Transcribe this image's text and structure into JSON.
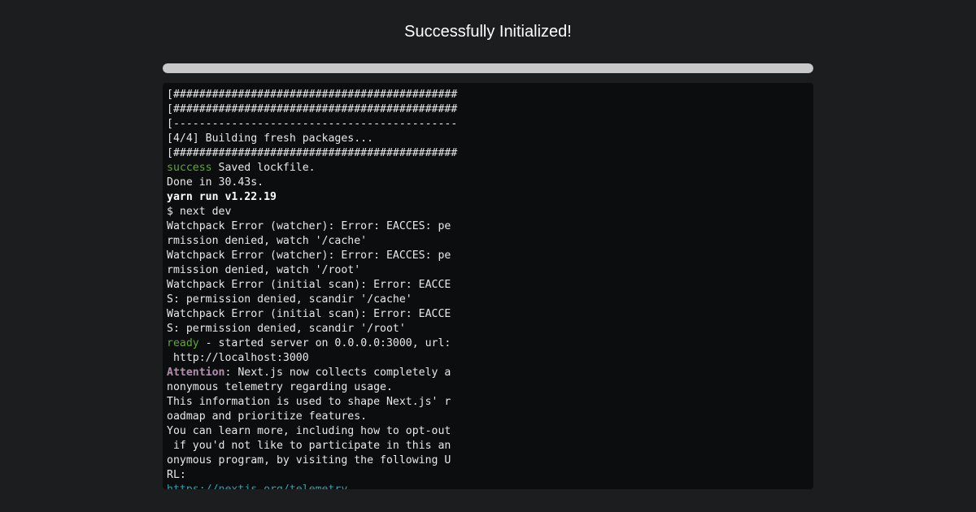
{
  "header": {
    "title": "Successfully Initialized!"
  },
  "progress": {
    "value": 1.0
  },
  "colors": {
    "background": "#1c1d1f",
    "terminal_bg": "#0c0d0e",
    "progress_fill": "#c8c8c8",
    "success_green": "#5fa63a",
    "attention_magenta": "#b48ead",
    "link_cyan": "#2aa1b3"
  },
  "terminal": {
    "lines": [
      [
        {
          "text": "[############################################",
          "style": ""
        }
      ],
      [
        {
          "text": "[############################################",
          "style": ""
        }
      ],
      [
        {
          "text": "[--------------------------------------------",
          "style": ""
        }
      ],
      [
        {
          "text": "[4/4] Building fresh packages...",
          "style": ""
        }
      ],
      [
        {
          "text": "[############################################",
          "style": ""
        }
      ],
      [
        {
          "text": "success",
          "style": "green"
        },
        {
          "text": " Saved lockfile.",
          "style": ""
        }
      ],
      [
        {
          "text": "Done in 30.43s.",
          "style": ""
        }
      ],
      [
        {
          "text": "yarn run v1.22.19",
          "style": "bold"
        }
      ],
      [
        {
          "text": "$ next dev",
          "style": ""
        }
      ],
      [
        {
          "text": "Watchpack Error (watcher): Error: EACCES: pe",
          "style": ""
        }
      ],
      [
        {
          "text": "rmission denied, watch '/cache'",
          "style": ""
        }
      ],
      [
        {
          "text": "Watchpack Error (watcher): Error: EACCES: pe",
          "style": ""
        }
      ],
      [
        {
          "text": "rmission denied, watch '/root'",
          "style": ""
        }
      ],
      [
        {
          "text": "Watchpack Error (initial scan): Error: EACCE",
          "style": ""
        }
      ],
      [
        {
          "text": "S: permission denied, scandir '/cache'",
          "style": ""
        }
      ],
      [
        {
          "text": "Watchpack Error (initial scan): Error: EACCE",
          "style": ""
        }
      ],
      [
        {
          "text": "S: permission denied, scandir '/root'",
          "style": ""
        }
      ],
      [
        {
          "text": "ready",
          "style": "green"
        },
        {
          "text": " - started server on 0.0.0.0:3000, url:",
          "style": ""
        }
      ],
      [
        {
          "text": " http://localhost:3000",
          "style": ""
        }
      ],
      [
        {
          "text": "Attention",
          "style": "magenta"
        },
        {
          "text": ": Next.js now collects completely a",
          "style": ""
        }
      ],
      [
        {
          "text": "nonymous telemetry regarding usage.",
          "style": ""
        }
      ],
      [
        {
          "text": "This information is used to shape Next.js' r",
          "style": ""
        }
      ],
      [
        {
          "text": "oadmap and prioritize features.",
          "style": ""
        }
      ],
      [
        {
          "text": "You can learn more, including how to opt-out",
          "style": ""
        }
      ],
      [
        {
          "text": " if you'd not like to participate in this an",
          "style": ""
        }
      ],
      [
        {
          "text": "onymous program, by visiting the following U",
          "style": ""
        }
      ],
      [
        {
          "text": "RL:",
          "style": ""
        }
      ],
      [
        {
          "text": "https://nextjs.org/telemetry",
          "style": "link"
        }
      ]
    ]
  }
}
